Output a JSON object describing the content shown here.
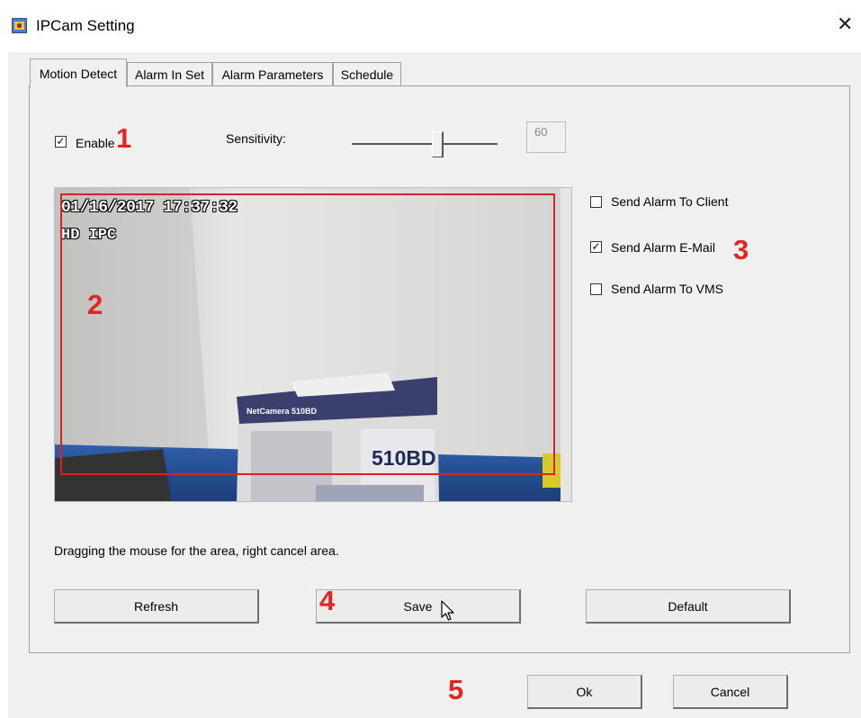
{
  "window": {
    "title": "IPCam Setting",
    "close_glyph": "✕",
    "icon": "app-icon"
  },
  "tabs": [
    {
      "label": "Motion Detect",
      "active": true
    },
    {
      "label": "Alarm In Set",
      "active": false
    },
    {
      "label": "Alarm Parameters",
      "active": false
    },
    {
      "label": "Schedule",
      "active": false
    }
  ],
  "motion": {
    "enable_label": "Enable",
    "enable_checked": true,
    "sensitivity_label": "Sensitivity:",
    "sensitivity_value": "60",
    "sensitivity_fraction": 0.6
  },
  "video": {
    "timestamp": "01/16/2017  17:37:32",
    "channel": "HD IPC",
    "box_text": "510BD",
    "box_brand": "NetCamera 510BD"
  },
  "alarm_options": [
    {
      "label": "Send Alarm To Client",
      "checked": false
    },
    {
      "label": "Send Alarm E-Mail",
      "checked": true
    },
    {
      "label": "Send Alarm To VMS",
      "checked": false
    }
  ],
  "hint": "Dragging the mouse for the area, right cancel area.",
  "buttons": {
    "refresh": "Refresh",
    "save": "Save",
    "default": "Default",
    "ok": "Ok",
    "cancel": "Cancel"
  },
  "annotations": [
    "1",
    "2",
    "3",
    "4",
    "5"
  ],
  "colors": {
    "annotation": "#e12525",
    "dialog_bg": "#f0f0f0",
    "detect_region": "#e02020"
  }
}
